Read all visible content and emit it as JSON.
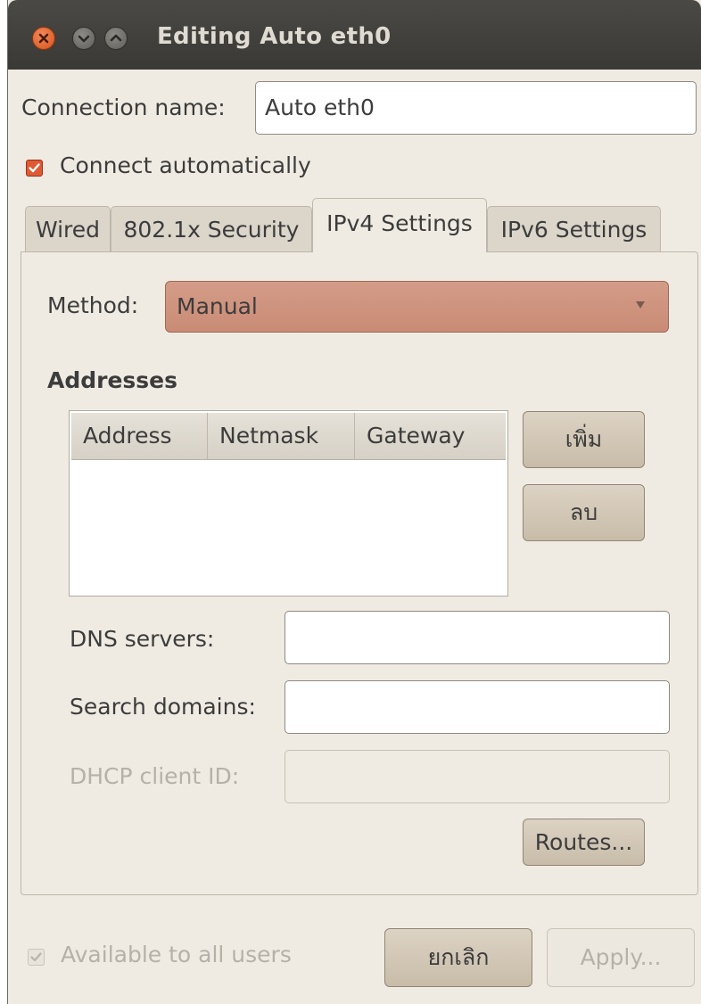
{
  "window": {
    "title": "Editing Auto eth0"
  },
  "connection": {
    "name_label": "Connection name:",
    "name_value": "Auto eth0",
    "auto_connect_label": "Connect automatically",
    "auto_connect_checked": true
  },
  "tabs": [
    {
      "label": "Wired",
      "active": false
    },
    {
      "label": "802.1x Security",
      "active": false
    },
    {
      "label": "IPv4 Settings",
      "active": true
    },
    {
      "label": "IPv6 Settings",
      "active": false
    }
  ],
  "ipv4": {
    "method_label": "Method:",
    "method_value": "Manual",
    "addresses_heading": "Addresses",
    "columns": [
      "Address",
      "Netmask",
      "Gateway"
    ],
    "rows": [],
    "add_button": "เพิ่ม",
    "delete_button": "ลบ",
    "dns_label": "DNS servers:",
    "dns_value": "",
    "search_label": "Search domains:",
    "search_value": "",
    "dhcp_label": "DHCP client ID:",
    "dhcp_value": "",
    "routes_button": "Routes..."
  },
  "footer": {
    "all_users_label": "Available to all users",
    "all_users_checked": true,
    "cancel_button": "ยกเลิก",
    "apply_button": "Apply..."
  },
  "colors": {
    "titlebar": "#3f3e3a",
    "close_button": "#e06a34",
    "checkbox_accent": "#de5a34",
    "method_combo": "#cf937e",
    "window_bg": "#f0ebe2"
  }
}
